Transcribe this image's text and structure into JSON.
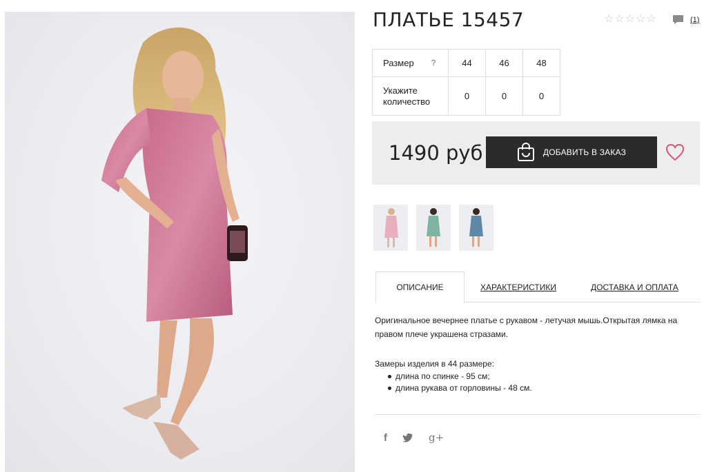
{
  "product": {
    "title": "ПЛАТЬЕ 15457",
    "rating": {
      "value": 0,
      "max": 5
    },
    "comments_count": "(1)"
  },
  "sizes": {
    "size_label": "Размер",
    "help_mark": "?",
    "quantity_label": "Укажите количество",
    "columns": [
      "44",
      "46",
      "48"
    ],
    "quantities": [
      "0",
      "0",
      "0"
    ]
  },
  "purchase": {
    "price": "1490 руб",
    "add_button": "ДОБАВИТЬ В ЗАКАЗ",
    "accent_color": "#d9547a",
    "button_color": "#2b2b2b"
  },
  "thumbnails": [
    {
      "name": "thumb-pink-dress",
      "color": "#e9aebe"
    },
    {
      "name": "thumb-green-dress",
      "color": "#7fb3a2"
    },
    {
      "name": "thumb-blue-dress",
      "color": "#5d88a8"
    }
  ],
  "tabs": {
    "description": "ОПИСАНИЕ",
    "characteristics": "ХАРАКТЕРИСТИКИ",
    "delivery": "ДОСТАВКА И ОПЛАТА"
  },
  "description": {
    "text": "Оригинальное вечернее платье с рукавом - летучая мышь.Открытая лямка на правом плече украшена стразами.",
    "measure_title": "Замеры изделия в 44 размере:",
    "measures": [
      "длина по спинке - 95 см;",
      "длина рукава от горловины - 48 см."
    ]
  },
  "social": {
    "facebook": "f",
    "twitter": "twitter-icon",
    "google": "g+"
  }
}
